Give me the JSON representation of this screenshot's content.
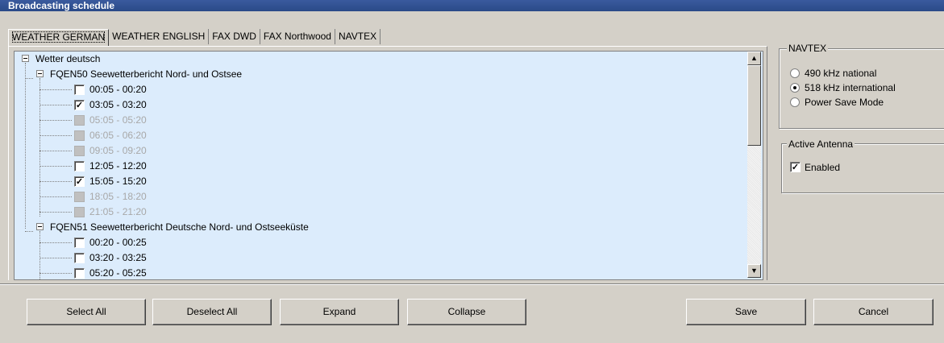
{
  "window": {
    "title": "Broadcasting schedule"
  },
  "tabs": [
    {
      "label": "WEATHER GERMAN",
      "active": true
    },
    {
      "label": "WEATHER ENGLISH",
      "active": false
    },
    {
      "label": "FAX DWD",
      "active": false
    },
    {
      "label": "FAX Northwood",
      "active": false
    },
    {
      "label": "NAVTEX",
      "active": false
    }
  ],
  "tree": {
    "root": "Wetter deutsch",
    "groups": [
      {
        "label": "FQEN50 Seewetterbericht Nord- und Ostsee",
        "items": [
          {
            "label": "00:05 - 00:20",
            "checked": false,
            "enabled": true
          },
          {
            "label": "03:05 - 03:20",
            "checked": true,
            "enabled": true
          },
          {
            "label": "05:05 - 05:20",
            "checked": false,
            "enabled": false
          },
          {
            "label": "06:05 - 06:20",
            "checked": false,
            "enabled": false
          },
          {
            "label": "09:05 - 09:20",
            "checked": false,
            "enabled": false
          },
          {
            "label": "12:05 - 12:20",
            "checked": false,
            "enabled": true
          },
          {
            "label": "15:05 - 15:20",
            "checked": true,
            "enabled": true
          },
          {
            "label": "18:05 - 18:20",
            "checked": false,
            "enabled": false
          },
          {
            "label": "21:05 - 21:20",
            "checked": false,
            "enabled": false
          }
        ]
      },
      {
        "label": "FQEN51 Seewetterbericht Deutsche Nord- und Ostseeküste",
        "items": [
          {
            "label": "00:20 - 00:25",
            "checked": false,
            "enabled": true
          },
          {
            "label": "03:20 - 03:25",
            "checked": false,
            "enabled": true
          },
          {
            "label": "05:20 - 05:25",
            "checked": false,
            "enabled": true
          }
        ]
      }
    ]
  },
  "navtex": {
    "title": "NAVTEX",
    "options": [
      {
        "label": "490 kHz national",
        "selected": false
      },
      {
        "label": "518 kHz international",
        "selected": true
      },
      {
        "label": "Power Save Mode",
        "selected": false
      }
    ]
  },
  "antenna": {
    "title": "Active Antenna",
    "enabled_label": "Enabled",
    "enabled": true
  },
  "buttons": {
    "select_all": "Select All",
    "deselect_all": "Deselect All",
    "expand": "Expand",
    "collapse": "Collapse",
    "save": "Save",
    "cancel": "Cancel"
  },
  "scrollbar": {
    "up_arrow": "▲",
    "down_arrow": "▼"
  },
  "colors": {
    "title_bar": "#2a4a88",
    "tree_background": "#dcecfc",
    "dialog_background": "#d4d0c8"
  }
}
